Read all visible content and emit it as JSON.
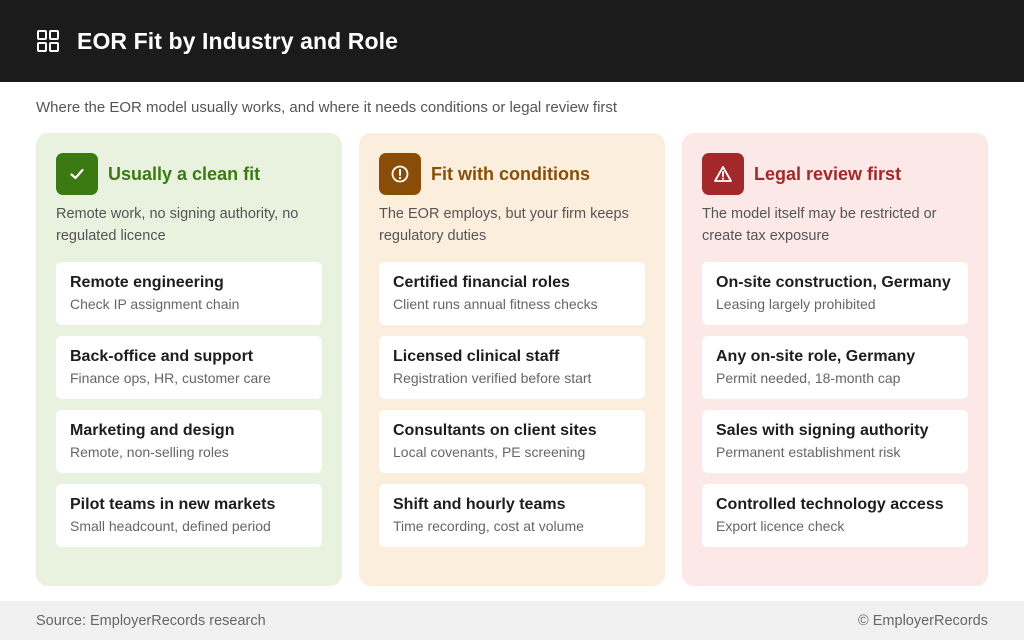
{
  "header": {
    "title": "EOR Fit by Industry and Role",
    "icon": "grid-icon"
  },
  "subtitle": "Where the EOR model usually works, and where it needs conditions or legal review first",
  "columns": [
    {
      "title": "Usually a clean fit",
      "icon": "check-icon",
      "color": "#3b7a12",
      "background": "#e8f2de",
      "description": "Remote work, no signing authority, no regulated licence",
      "items": [
        {
          "title": "Remote engineering",
          "subtitle": "Check IP assignment chain"
        },
        {
          "title": "Back-office and support",
          "subtitle": "Finance ops, HR, customer care"
        },
        {
          "title": "Marketing and design",
          "subtitle": "Remote, non-selling roles"
        },
        {
          "title": "Pilot teams in new markets",
          "subtitle": "Small headcount, defined period"
        }
      ]
    },
    {
      "title": "Fit with conditions",
      "icon": "alert-circle-icon",
      "color": "#8a4d08",
      "background": "#fbeedd",
      "description": "The EOR employs, but your firm keeps regulatory duties",
      "items": [
        {
          "title": "Certified financial roles",
          "subtitle": "Client runs annual fitness checks"
        },
        {
          "title": "Licensed clinical staff",
          "subtitle": "Registration verified before start"
        },
        {
          "title": "Consultants on client sites",
          "subtitle": "Local covenants, PE screening"
        },
        {
          "title": "Shift and hourly teams",
          "subtitle": "Time recording, cost at volume"
        }
      ]
    },
    {
      "title": "Legal review first",
      "icon": "warning-triangle-icon",
      "color": "#a3282a",
      "background": "#fbe8e7",
      "description": "The model itself may be restricted or create tax exposure",
      "items": [
        {
          "title": "On-site construction, Germany",
          "subtitle": "Leasing largely prohibited"
        },
        {
          "title": "Any on-site role, Germany",
          "subtitle": "Permit needed, 18-month cap"
        },
        {
          "title": "Sales with signing authority",
          "subtitle": "Permanent establishment risk"
        },
        {
          "title": "Controlled technology access",
          "subtitle": "Export licence check"
        }
      ]
    }
  ],
  "footer": {
    "source": "Source: EmployerRecords research",
    "copyright": "© EmployerRecords"
  }
}
